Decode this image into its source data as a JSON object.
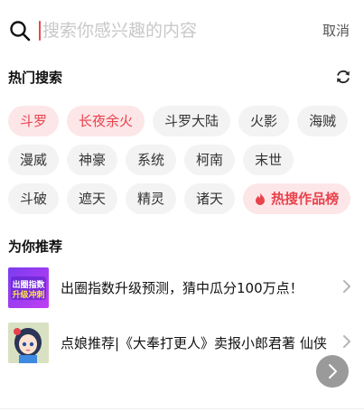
{
  "search": {
    "placeholder": "搜索你感兴趣的内容",
    "value": "",
    "cancel_label": "取消"
  },
  "hot_search": {
    "title": "热门搜索",
    "refresh_icon": "refresh-icon",
    "rows": [
      [
        {
          "label": "斗罗",
          "style": "hot"
        },
        {
          "label": "长夜余火",
          "style": "hot"
        },
        {
          "label": "斗罗大陆",
          "style": "normal"
        },
        {
          "label": "火影",
          "style": "normal"
        },
        {
          "label": "海贼",
          "style": "normal"
        }
      ],
      [
        {
          "label": "漫威",
          "style": "normal"
        },
        {
          "label": "神豪",
          "style": "normal"
        },
        {
          "label": "系统",
          "style": "normal"
        },
        {
          "label": "柯南",
          "style": "normal"
        },
        {
          "label": "末世",
          "style": "normal"
        }
      ],
      [
        {
          "label": "斗破",
          "style": "normal"
        },
        {
          "label": "遮天",
          "style": "normal"
        },
        {
          "label": "精灵",
          "style": "normal"
        },
        {
          "label": "诸天",
          "style": "normal"
        },
        {
          "label": "热搜作品榜",
          "style": "rank",
          "icon": "flame-icon"
        }
      ]
    ]
  },
  "recommend": {
    "title": "为你推荐",
    "items": [
      {
        "text": "出圈指数升级预测，猜中瓜分100万点！",
        "thumb_caption": "出圈指数升级冲刺",
        "thumb_icon": "promo-banner-thumbnail"
      },
      {
        "text": "点娘推荐|《大奉打更人》卖报小郎君著 仙侠",
        "thumb_icon": "anime-girl-thumbnail"
      }
    ]
  },
  "colors": {
    "accent": "#e8424c",
    "chip_bg": "#f3f3f3",
    "chip_hot_bg": "#fde6e8"
  }
}
